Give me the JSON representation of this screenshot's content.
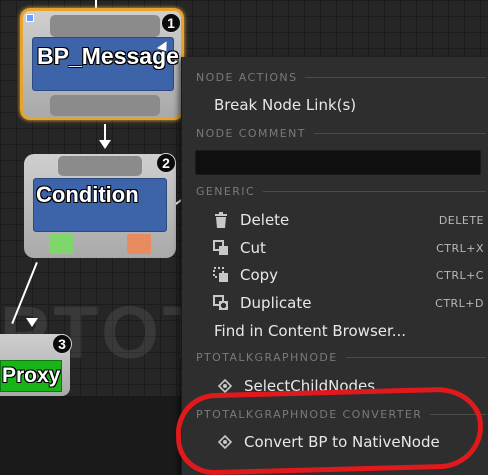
{
  "watermark_text": "PTOTAL",
  "nodes": [
    {
      "title": "BP_Message",
      "badge": "1",
      "selected": true
    },
    {
      "title": "Condition",
      "badge": "2",
      "selected": false
    },
    {
      "title": "Proxy",
      "badge": "3",
      "selected": false
    }
  ],
  "colors": {
    "selection_border": "#e8a32a",
    "node_title_bg": "#3d63a8",
    "pin_green": "#7fd66a",
    "pin_orange": "#e98b60",
    "proxy_green": "#18b418",
    "highlight_red": "#e0191c"
  },
  "menu": {
    "sections": {
      "node_actions": "NODE ACTIONS",
      "node_comment": "NODE COMMENT",
      "generic": "GENERIC",
      "graph_node": "PTOTALKGRAPHNODE",
      "converter": "PTOTALKGRAPHNODE CONVERTER"
    },
    "break_links": {
      "label": "Break Node Link(s)"
    },
    "comment_value": "",
    "generic_items": [
      {
        "label": "Delete",
        "shortcut": "DELETE",
        "icon": "trash-icon"
      },
      {
        "label": "Cut",
        "shortcut": "CTRL+X",
        "icon": "cut-icon"
      },
      {
        "label": "Copy",
        "shortcut": "CTRL+C",
        "icon": "copy-icon"
      },
      {
        "label": "Duplicate",
        "shortcut": "CTRL+D",
        "icon": "duplicate-icon"
      }
    ],
    "find_in_browser": {
      "label": "Find in Content Browser..."
    },
    "select_child_nodes": {
      "label": "SelectChildNodes",
      "icon": "node-action-icon"
    },
    "convert_bp": {
      "label": "Convert BP to NativeNode",
      "icon": "node-action-icon"
    }
  }
}
